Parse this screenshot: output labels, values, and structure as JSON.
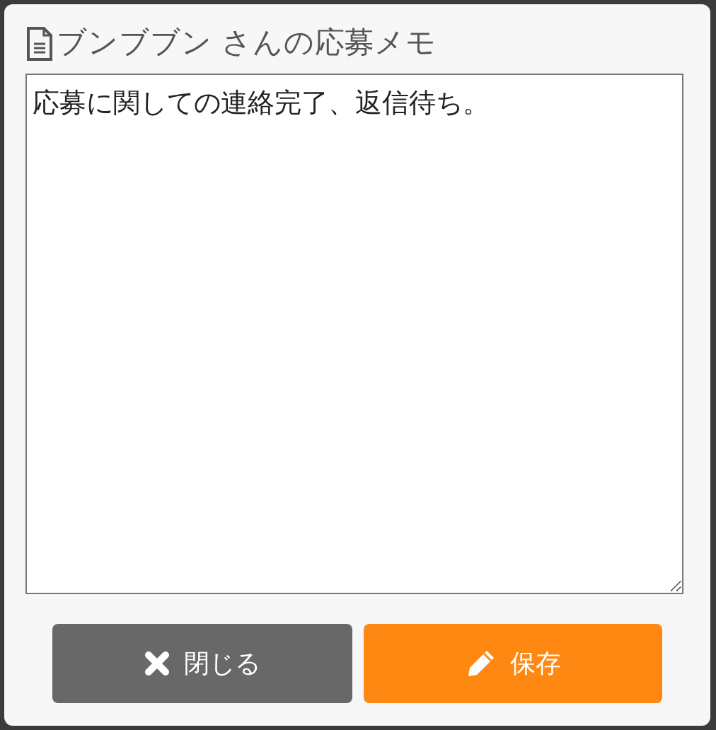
{
  "dialog": {
    "title": "ブンブブン さんの応募メモ"
  },
  "memo": {
    "value": "応募に関しての連絡完了、返信待ち。"
  },
  "buttons": [
    {
      "kind": "close",
      "label": "閉じる"
    },
    {
      "kind": "save",
      "label": "保存"
    }
  ]
}
